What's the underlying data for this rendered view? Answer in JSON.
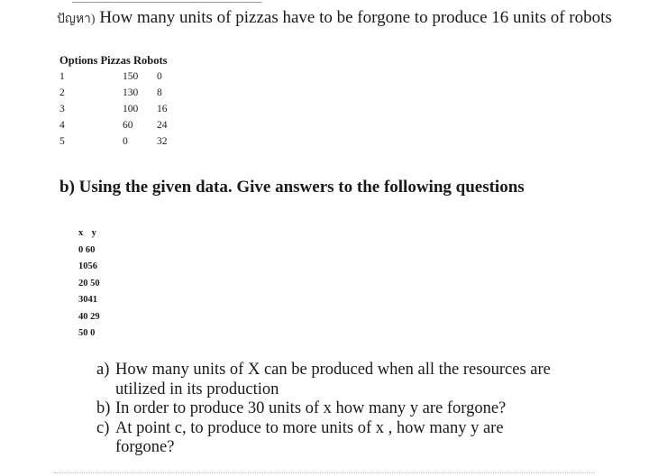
{
  "question_a": {
    "prefix": "ปัญหา)",
    "text": "How many units of pizzas have to be forgone to produce 16 units of robots"
  },
  "table_pizzas_robots": {
    "headers": [
      "Options",
      "Pizzas",
      "Robots"
    ],
    "rows": [
      [
        "1",
        "150",
        "0"
      ],
      [
        "2",
        "130",
        "8"
      ],
      [
        "3",
        "100",
        "16"
      ],
      [
        "4",
        "60",
        "24"
      ],
      [
        "5",
        "0",
        "32"
      ]
    ]
  },
  "question_b": {
    "text": "b) Using the given data. Give answers to the following questions"
  },
  "table_xy": {
    "headers": [
      "x",
      "y"
    ],
    "rows": [
      [
        "0",
        "60"
      ],
      [
        "10",
        "56"
      ],
      [
        "20",
        "50"
      ],
      [
        "30",
        "41"
      ],
      [
        "40",
        "29"
      ],
      [
        "50",
        "0"
      ]
    ]
  },
  "sub_questions": [
    {
      "label": "a)",
      "text": "How many units of X can be produced when all the resources are utilized in its production"
    },
    {
      "label": "b)",
      "text": "In order to produce 30 units of x how many y are forgone?"
    },
    {
      "label": "c)",
      "text": "At point c, to produce to more units of x , how many y are forgone?"
    }
  ]
}
